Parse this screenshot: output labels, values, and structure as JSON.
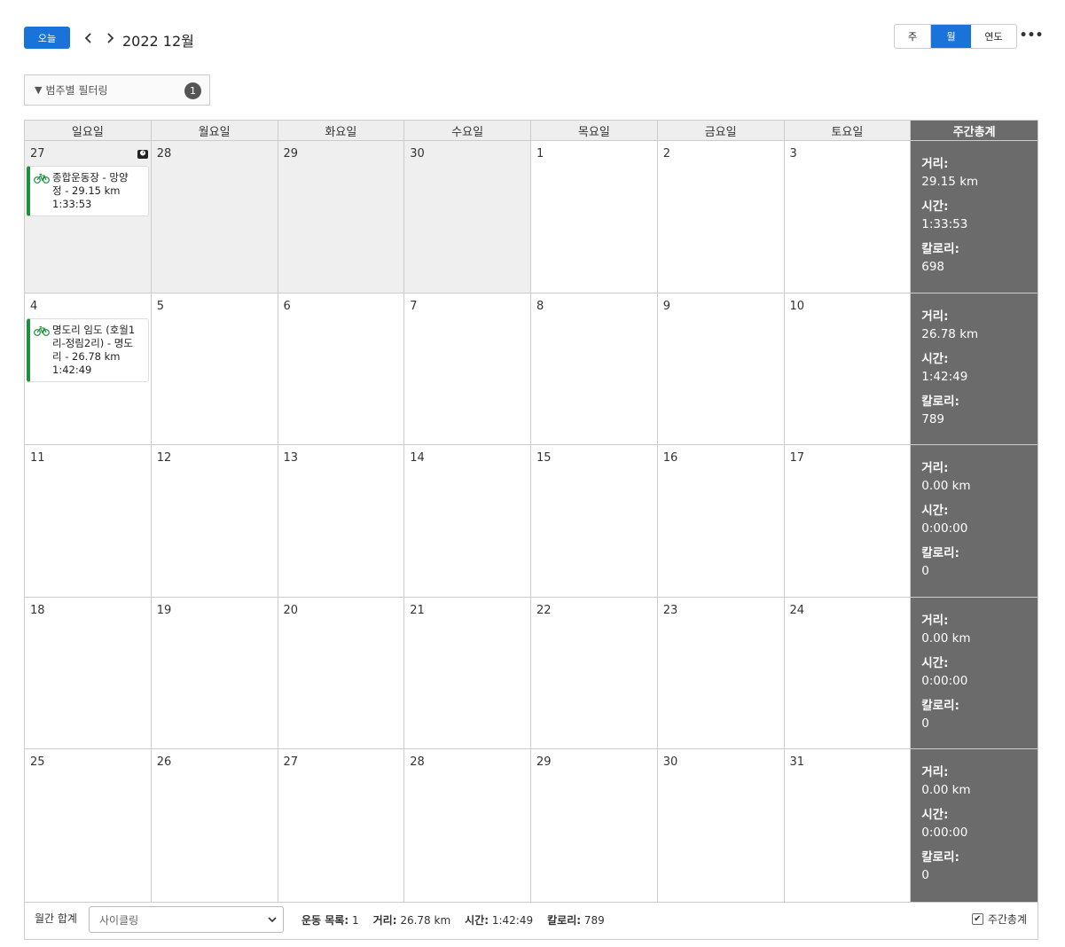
{
  "header": {
    "today_label": "오늘",
    "month_title": "2022 12월",
    "views": {
      "week": "주",
      "month": "월",
      "year": "연도"
    },
    "more_label": "•••"
  },
  "filter": {
    "label": "범주별 필터링",
    "count": "1"
  },
  "calendar": {
    "weekdays": [
      "일요일",
      "월요일",
      "화요일",
      "수요일",
      "목요일",
      "금요일",
      "토요일"
    ],
    "total_header": "주간총계",
    "weeks": [
      {
        "days": [
          "27",
          "28",
          "29",
          "30",
          "1",
          "2",
          "3"
        ],
        "distance": "29.15 km",
        "time": "1:33:53",
        "calories": "698"
      },
      {
        "days": [
          "4",
          "5",
          "6",
          "7",
          "8",
          "9",
          "10"
        ],
        "distance": "26.78 km",
        "time": "1:42:49",
        "calories": "789"
      },
      {
        "days": [
          "11",
          "12",
          "13",
          "14",
          "15",
          "16",
          "17"
        ],
        "distance": "0.00 km",
        "time": "0:00:00",
        "calories": "0"
      },
      {
        "days": [
          "18",
          "19",
          "20",
          "21",
          "22",
          "23",
          "24"
        ],
        "distance": "0.00 km",
        "time": "0:00:00",
        "calories": "0"
      },
      {
        "days": [
          "25",
          "26",
          "27",
          "28",
          "29",
          "30",
          "31"
        ],
        "distance": "0.00 km",
        "time": "0:00:00",
        "calories": "0"
      }
    ],
    "total_labels": {
      "distance": "거리:",
      "time": "시간:",
      "calories": "칼로리:"
    },
    "events": [
      {
        "line1": "종합운동장 - 망양",
        "line2": "정 - 29.15 km",
        "line3": "1:33:53"
      },
      {
        "line1": "명도리 임도 (호월1",
        "line2": "리-정림2리) - 명도",
        "line3": "리 - 26.78 km",
        "line4": "1:42:49"
      }
    ]
  },
  "footer": {
    "label": "월간 합계",
    "activity_select": "사이클링",
    "workouts_label": "운동 목록:",
    "workouts_value": "1",
    "distance_label": "거리:",
    "distance_value": "26.78 km",
    "time_label": "시간:",
    "time_value": "1:42:49",
    "calories_label": "칼로리:",
    "calories_value": "789",
    "weekly_total_label": "주간총계"
  },
  "colors": {
    "accent": "#1a73d9",
    "event_bar": "#1e8f3e",
    "totals_bg": "#6b6b6b"
  }
}
